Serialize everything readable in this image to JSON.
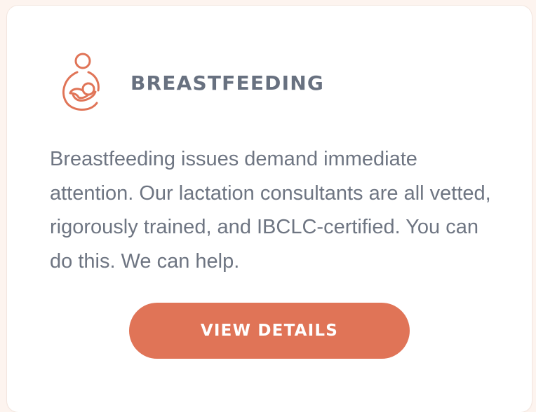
{
  "card": {
    "icon": "mother-nursing-baby-icon",
    "title": "BREASTFEEDING",
    "description": "Breastfeeding issues demand immediate attention. Our lactation consultants are all vetted, rigorously trained, and IBCLC-certified. You can do this. We can help.",
    "button_label": "VIEW DETAILS"
  },
  "colors": {
    "accent": "#e07457",
    "title_text": "#687180",
    "body_text": "#6e7582",
    "page_background": "#fdf4ef",
    "card_background": "#ffffff"
  }
}
